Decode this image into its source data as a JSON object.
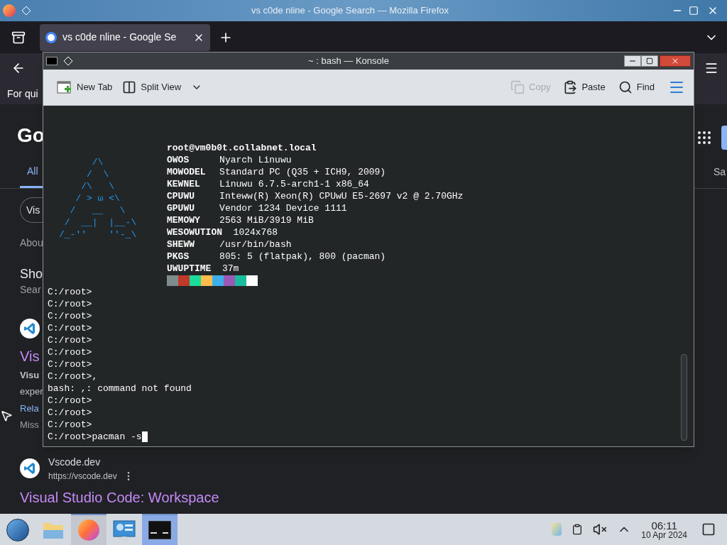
{
  "firefox": {
    "title": "vs c0de nline - Google Search — Mozilla Firefox",
    "tab": {
      "label": "vs c0de nline - Google Se",
      "selected": true
    },
    "bookmark_hint": "For qui",
    "page": {
      "logo": "Go",
      "tabs": [
        {
          "label": "All",
          "selected": true
        }
      ],
      "right_tab": "Sa",
      "chip": "Vis",
      "stats": "Abou",
      "section_title": "Sho",
      "section_sub": "Sear",
      "result1": {
        "title": "Vis",
        "bold": "Visu",
        "snippet": "exper",
        "link": "Rela",
        "missing": "Miss"
      },
      "result2": {
        "site": "Vscode.dev",
        "url": "https://vscode.dev",
        "title": "Visual Studio Code: Workspace"
      }
    }
  },
  "konsole": {
    "title": "~ : bash — Konsole",
    "toolbar": [
      {
        "kind": "new-tab",
        "label": "New Tab",
        "disabled": false
      },
      {
        "kind": "split",
        "label": "Split View",
        "disabled": false
      },
      {
        "kind": "copy",
        "label": "Copy",
        "disabled": true
      },
      {
        "kind": "paste",
        "label": "Paste",
        "disabled": false
      },
      {
        "kind": "find",
        "label": "Find",
        "disabled": false
      }
    ],
    "terminal": {
      "logo": [
        "      /\\",
        "     /  \\",
        "    /\\   \\",
        "   / > ω <\\",
        "  /   __   \\",
        " /  __|  |__-\\",
        "/_-''    ''-_\\"
      ],
      "host": "root@vm0b0t.collabnet.local",
      "info": [
        {
          "label": "OWOS",
          "value": "Nyarch Linuwu"
        },
        {
          "label": "MOWODEL",
          "value": "Standard PC (Q35 + ICH9, 2009)"
        },
        {
          "label": "KEWNEL",
          "value": "Linuwu 6.7.5-arch1-1 x86_64"
        },
        {
          "label": "CPUWU",
          "value": "Inteww(R) Xeon(R) CPUwU E5-2697 v2 @ 2.70GHz"
        },
        {
          "label": "GPUWU",
          "value": "Vendor 1234 Device 1111"
        },
        {
          "label": "MEMOWY",
          "value": "2563 MiB/3919 MiB"
        },
        {
          "label": "WESOWUTION",
          "value": "1024x768"
        },
        {
          "label": "SHEWW",
          "value": "/usr/bin/bash"
        },
        {
          "label": "PKGS",
          "value": "805: 5 (flatpak), 800 (pacman)"
        },
        {
          "label": "UWUPTIME",
          "value": "37m"
        }
      ],
      "palette": [
        {
          "color": "#7f8c8d"
        },
        {
          "color": "#c0392b"
        },
        {
          "color": "#1cdc9a"
        },
        {
          "color": "#fdbc4b"
        },
        {
          "color": "#3daee9"
        },
        {
          "color": "#9b59b6"
        },
        {
          "color": "#1abc9c"
        },
        {
          "color": "#fcfcfc"
        }
      ],
      "lines": [
        "C:/root>",
        "C:/root>",
        "C:/root>",
        "C:/root>",
        "C:/root>",
        "C:/root>",
        "C:/root>",
        "C:/root>,",
        "bash: ,: command not found",
        "C:/root>",
        "C:/root>",
        "C:/root>",
        "C:/root>pacman -s"
      ],
      "cursor": true
    }
  },
  "taskbar": {
    "items": [
      {
        "kind": "start",
        "running": false,
        "selected": false
      },
      {
        "kind": "folder",
        "running": false,
        "selected": false
      },
      {
        "kind": "browser",
        "running": true,
        "selected": false
      },
      {
        "kind": "monitor",
        "running": false,
        "selected": false
      },
      {
        "kind": "terminal",
        "running": true,
        "selected": true
      }
    ],
    "time": "06:11",
    "date": "10 Apr 2024",
    "muted": true
  }
}
